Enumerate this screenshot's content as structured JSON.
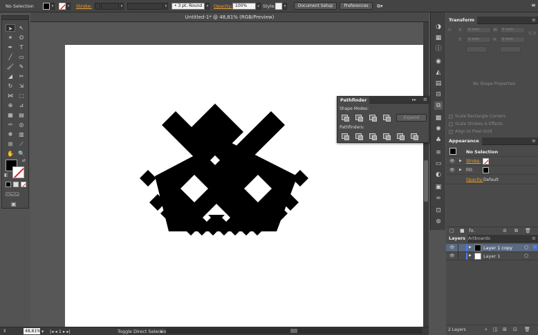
{
  "control_bar": {
    "selection_label": "No Selection",
    "stroke_label": "Stroke:",
    "stroke_weight": "3 pt. Round",
    "opacity_label": "Opacity:",
    "opacity_value": "100%",
    "style_label": "Style:",
    "document_setup": "Document Setup",
    "preferences": "Preferences"
  },
  "document": {
    "tab_title": "Untitled-1* @ 48,81% (RGB/Preview)"
  },
  "status_bar": {
    "zoom": "48,81%",
    "status_text": "Toggle Direct Selection"
  },
  "pathfinder": {
    "tab": "Pathfinder",
    "shape_modes": "Shape Modes:",
    "expand": "Expand",
    "pathfinders": "Pathfinders:"
  },
  "transform": {
    "tab": "Transform",
    "x_label": "X:",
    "y_label": "Y:",
    "w_label": "W:",
    "h_label": "H:",
    "field_placeholder": "0 mm",
    "no_shape": "No Shape Properties",
    "scale_corners": "Scale Rectangle Corners",
    "scale_strokes": "Scale Strokes & Effects",
    "align_pixel": "Align to Pixel Grid"
  },
  "appearance": {
    "tab": "Appearance",
    "title": "No Selection",
    "stroke_label": "Stroke:",
    "fill_label": "Fill:",
    "opacity_label": "Opacity:",
    "opacity_value": "Default"
  },
  "layers": {
    "tab": "Layers",
    "tab_artboards": "Artboards",
    "rows": [
      {
        "name": "Layer 1 copy",
        "selected": true
      },
      {
        "name": "Layer 1",
        "selected": false
      }
    ],
    "count": "2 Layers"
  },
  "colors": {
    "accent_orange": "#f0a030",
    "layer_color": "#4a7cff",
    "panel_bg": "#4a4a4a",
    "artwork": "#000000"
  }
}
